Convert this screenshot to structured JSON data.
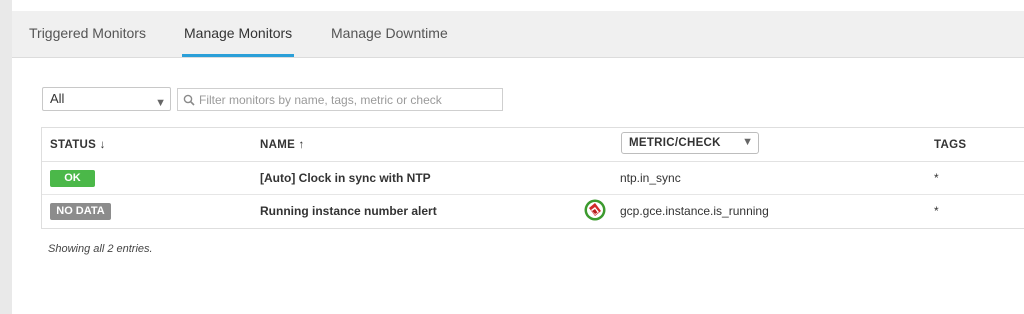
{
  "tabs": {
    "triggered": "Triggered Monitors",
    "manage": "Manage Monitors",
    "downtime": "Manage Downtime"
  },
  "filter": {
    "selected": "All",
    "search_placeholder": "Filter monitors by name, tags, metric or check"
  },
  "table": {
    "headers": {
      "status": "STATUS ↓",
      "name": "NAME ↑",
      "metric": "METRIC/CHECK",
      "tags": "TAGS"
    },
    "rows": [
      {
        "status": "OK",
        "name": "[Auto] Clock in sync with NTP",
        "metric": "ntp.in_sync",
        "tags": "*"
      },
      {
        "status": "NO DATA",
        "name": "Running instance number alert",
        "metric": "gcp.gce.instance.is_running",
        "tags": "*"
      }
    ]
  },
  "footer": {
    "entries_text": "Showing all 2 entries."
  },
  "colors": {
    "tab_active_underline": "#2b9fd8",
    "status_ok": "#4bb849",
    "status_no_data": "#8c8c8c"
  },
  "icons": {
    "search": "search-icon",
    "caret": "caret-down-icon",
    "creator": "user-avatar-icon"
  }
}
